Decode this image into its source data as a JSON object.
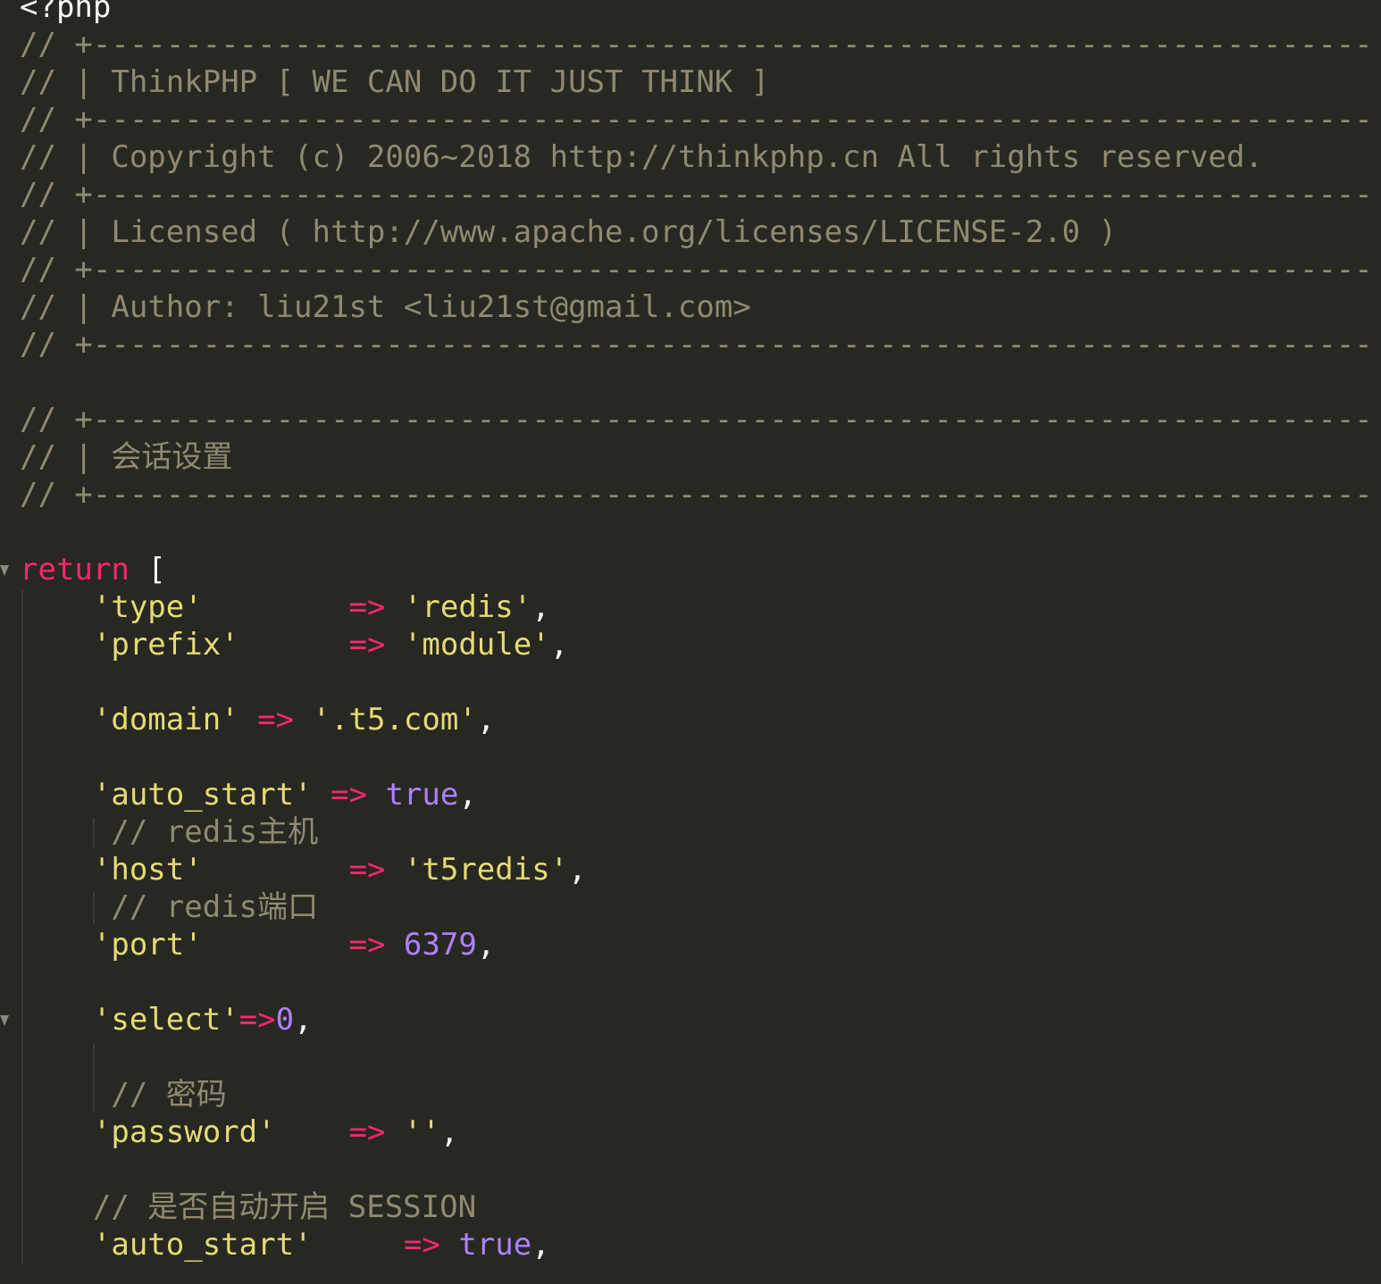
{
  "editor": {
    "lines": [
      {
        "parts": [
          {
            "t": "<?php",
            "c": "plain"
          }
        ]
      },
      {
        "parts": [
          {
            "t": "// +----------------------------------------------------------------------",
            "c": "cm"
          }
        ]
      },
      {
        "parts": [
          {
            "t": "// | ThinkPHP [ WE CAN DO IT JUST THINK ]",
            "c": "cm"
          }
        ]
      },
      {
        "parts": [
          {
            "t": "// +----------------------------------------------------------------------",
            "c": "cm"
          }
        ]
      },
      {
        "parts": [
          {
            "t": "// | Copyright (c) 2006~2018 http://thinkphp.cn All rights reserved.",
            "c": "cm"
          }
        ]
      },
      {
        "parts": [
          {
            "t": "// +----------------------------------------------------------------------",
            "c": "cm"
          }
        ]
      },
      {
        "parts": [
          {
            "t": "// | Licensed ( http://www.apache.org/licenses/LICENSE-2.0 )",
            "c": "cm"
          }
        ]
      },
      {
        "parts": [
          {
            "t": "// +----------------------------------------------------------------------",
            "c": "cm"
          }
        ]
      },
      {
        "parts": [
          {
            "t": "// | Author: liu21st <liu21st@gmail.com>",
            "c": "cm"
          }
        ]
      },
      {
        "parts": [
          {
            "t": "// +----------------------------------------------------------------------",
            "c": "cm"
          }
        ]
      },
      {
        "parts": []
      },
      {
        "parts": [
          {
            "t": "// +----------------------------------------------------------------------",
            "c": "cm"
          }
        ]
      },
      {
        "parts": [
          {
            "t": "// | 会话设置",
            "c": "cm"
          }
        ]
      },
      {
        "parts": [
          {
            "t": "// +----------------------------------------------------------------------",
            "c": "cm"
          }
        ]
      },
      {
        "parts": []
      },
      {
        "parts": [
          {
            "t": "return",
            "c": "kw"
          },
          {
            "t": " [",
            "c": "plain"
          }
        ]
      },
      {
        "parts": [
          {
            "t": "    ",
            "c": "plain"
          },
          {
            "t": "'type'",
            "c": "str"
          },
          {
            "t": "        ",
            "c": "plain"
          },
          {
            "t": "=>",
            "c": "op"
          },
          {
            "t": " ",
            "c": "plain"
          },
          {
            "t": "'redis'",
            "c": "str"
          },
          {
            "t": ",",
            "c": "plain"
          }
        ]
      },
      {
        "parts": [
          {
            "t": "    ",
            "c": "plain"
          },
          {
            "t": "'prefix'",
            "c": "str"
          },
          {
            "t": "      ",
            "c": "plain"
          },
          {
            "t": "=>",
            "c": "op"
          },
          {
            "t": " ",
            "c": "plain"
          },
          {
            "t": "'module'",
            "c": "str"
          },
          {
            "t": ",",
            "c": "plain"
          }
        ]
      },
      {
        "parts": []
      },
      {
        "parts": [
          {
            "t": "    ",
            "c": "plain"
          },
          {
            "t": "'domain'",
            "c": "str"
          },
          {
            "t": " ",
            "c": "plain"
          },
          {
            "t": "=>",
            "c": "op"
          },
          {
            "t": " ",
            "c": "plain"
          },
          {
            "t": "'.t5.com'",
            "c": "str"
          },
          {
            "t": ",",
            "c": "plain"
          }
        ]
      },
      {
        "parts": []
      },
      {
        "parts": [
          {
            "t": "    ",
            "c": "plain"
          },
          {
            "t": "'auto_start'",
            "c": "str"
          },
          {
            "t": " ",
            "c": "plain"
          },
          {
            "t": "=>",
            "c": "op"
          },
          {
            "t": " ",
            "c": "plain"
          },
          {
            "t": "true",
            "c": "bool"
          },
          {
            "t": ",",
            "c": "plain"
          }
        ]
      },
      {
        "parts": [
          {
            "t": "     // redis主机",
            "c": "cm"
          }
        ]
      },
      {
        "parts": [
          {
            "t": "    ",
            "c": "plain"
          },
          {
            "t": "'host'",
            "c": "str"
          },
          {
            "t": "        ",
            "c": "plain"
          },
          {
            "t": "=>",
            "c": "op"
          },
          {
            "t": " ",
            "c": "plain"
          },
          {
            "t": "'t5redis'",
            "c": "str"
          },
          {
            "t": ",",
            "c": "plain"
          }
        ]
      },
      {
        "parts": [
          {
            "t": "     // redis端口",
            "c": "cm"
          }
        ]
      },
      {
        "parts": [
          {
            "t": "    ",
            "c": "plain"
          },
          {
            "t": "'port'",
            "c": "str"
          },
          {
            "t": "        ",
            "c": "plain"
          },
          {
            "t": "=>",
            "c": "op"
          },
          {
            "t": " ",
            "c": "plain"
          },
          {
            "t": "6379",
            "c": "num"
          },
          {
            "t": ",",
            "c": "plain"
          }
        ]
      },
      {
        "parts": []
      },
      {
        "parts": [
          {
            "t": "    ",
            "c": "plain"
          },
          {
            "t": "'select'",
            "c": "str"
          },
          {
            "t": "=>",
            "c": "op"
          },
          {
            "t": "0",
            "c": "num"
          },
          {
            "t": ",",
            "c": "plain"
          }
        ]
      },
      {
        "parts": []
      },
      {
        "parts": [
          {
            "t": "     // 密码",
            "c": "cm"
          }
        ]
      },
      {
        "parts": [
          {
            "t": "    ",
            "c": "plain"
          },
          {
            "t": "'password'",
            "c": "str"
          },
          {
            "t": "    ",
            "c": "plain"
          },
          {
            "t": "=>",
            "c": "op"
          },
          {
            "t": " ",
            "c": "plain"
          },
          {
            "t": "''",
            "c": "str"
          },
          {
            "t": ",",
            "c": "plain"
          }
        ]
      },
      {
        "parts": []
      },
      {
        "parts": [
          {
            "t": "    // 是否自动开启 SESSION",
            "c": "cm"
          }
        ]
      },
      {
        "parts": [
          {
            "t": "    ",
            "c": "plain"
          },
          {
            "t": "'auto_start'",
            "c": "str"
          },
          {
            "t": "     ",
            "c": "plain"
          },
          {
            "t": "=>",
            "c": "op"
          },
          {
            "t": " ",
            "c": "plain"
          },
          {
            "t": "true",
            "c": "bool"
          },
          {
            "t": ",",
            "c": "plain"
          }
        ]
      }
    ]
  },
  "colors": {
    "background": "#272822",
    "comment": "#8f8a70",
    "keyword": "#f92672",
    "string": "#e6db74",
    "constant": "#ae81ff",
    "text": "#f8f8f2"
  },
  "gutter": {
    "fold_markers": [
      {
        "line": 15,
        "icon": "fold-triangle-icon"
      },
      {
        "line": 27,
        "icon": "fold-triangle-icon"
      }
    ]
  }
}
